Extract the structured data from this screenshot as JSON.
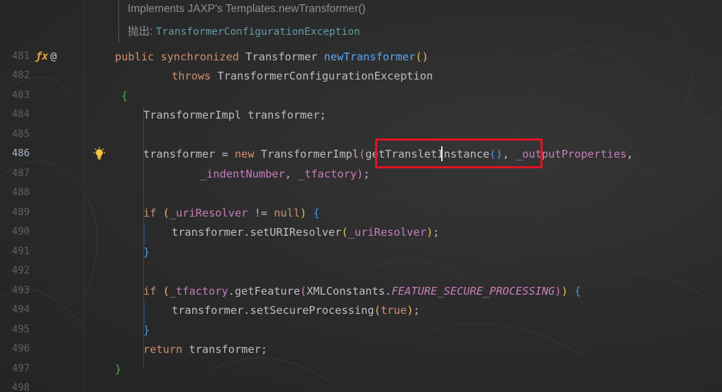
{
  "doc": {
    "line1": "Implements JAXP's Templates.newTransformer()",
    "throws_label": "抛出:",
    "throws_value": "TransformerConfigurationException"
  },
  "gutter": {
    "line_numbers": [
      "481",
      "482",
      "483",
      "484",
      "485",
      "486",
      "487",
      "488",
      "489",
      "490",
      "491",
      "492",
      "493",
      "494",
      "495",
      "496",
      "497",
      "498"
    ],
    "override_icon": "ƒx",
    "annotation_icon": "@"
  },
  "code": {
    "l481": {
      "kw1": "public",
      "kw2": "synchronized",
      "type": "Transformer",
      "fn": "newTransformer",
      "paren": "()"
    },
    "l482": {
      "kw": "throws",
      "type": "TransformerConfigurationException"
    },
    "l483": {
      "brace": "{"
    },
    "l484": {
      "text": "TransformerImpl transformer;"
    },
    "l486": {
      "a": "transformer = ",
      "kw": "new",
      "b": " TransformerImpl",
      "p": "(",
      "call": "getTransletInstance",
      "callp": "()",
      "comma": ", ",
      "f1": "_outputProperties",
      "end": ","
    },
    "l487": {
      "f1": "_indentNumber",
      "c": ", ",
      "f2": "_tfactory",
      "p": ")",
      "semi": ";"
    },
    "l489": {
      "kw": "if",
      "p1": " (",
      "f": "_uriResolver",
      "op": " != ",
      "nul": "null",
      "p2": ") ",
      "b": "{"
    },
    "l490": {
      "a": "transformer.setURIResolver",
      "p1": "(",
      "f": "_uriResolver",
      "p2": ")",
      "semi": ";"
    },
    "l491": {
      "b": "}"
    },
    "l493": {
      "kw": "if",
      "p1": " (",
      "f": "_tfactory",
      "m": ".getFeature",
      "p2": "(",
      "cls": "XMLConstants.",
      "const": "FEATURE_SECURE_PROCESSING",
      "p3": ")",
      "p4": ")",
      "sp": " ",
      "b": "{"
    },
    "l494": {
      "a": "transformer.setSecureProcessing",
      "p1": "(",
      "val": "true",
      "p2": ")",
      "semi": ";"
    },
    "l495": {
      "b": "}"
    },
    "l496": {
      "kw": "return",
      "a": " transformer;"
    },
    "l497": {
      "b": "}"
    }
  }
}
